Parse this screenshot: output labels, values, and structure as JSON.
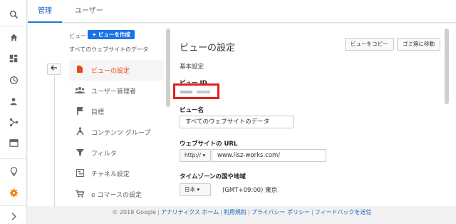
{
  "rail": {
    "icons": [
      "search-icon",
      "home-icon",
      "dashboard-icon",
      "clock-icon",
      "person-icon",
      "acquisition-icon",
      "behavior-icon",
      "lightbulb-icon",
      "gear-icon",
      "chevron-right-icon"
    ],
    "active_color": "#f57c00"
  },
  "tabs": {
    "admin": "管理",
    "user": "ユーザー"
  },
  "view_column": {
    "label": "ビュー",
    "create_button": "+ ビューを作成",
    "view_name": "すべてのウェブサイトのデータ",
    "items": [
      {
        "label": "ビューの設定",
        "icon": "document-icon"
      },
      {
        "label": "ユーザー管理者",
        "icon": "people-icon"
      },
      {
        "label": "目標",
        "icon": "flag-icon"
      },
      {
        "label": "コンテンツ グループ",
        "icon": "content-group-icon"
      },
      {
        "label": "フィルタ",
        "icon": "filter-icon"
      },
      {
        "label": "チャネル設定",
        "icon": "channel-icon"
      },
      {
        "label": "e コマースの設定",
        "icon": "cart-icon"
      }
    ]
  },
  "settings": {
    "title": "ビューの設定",
    "copy_button": "ビューをコピー",
    "trash_button": "ゴミ箱に移動",
    "basic_section": "基本設定",
    "view_id_label": "ビュー ID",
    "view_name_label": "ビュー名",
    "view_name_value": "すべてのウェブサイトのデータ",
    "url_label": "ウェブサイトの URL",
    "url_protocol": "http:// ▾",
    "url_value": "www.lisz-works.com/",
    "timezone_label": "タイムゾーンの国や地域",
    "timezone_country": "日本 ▾",
    "timezone_value": "(GMT+09:00) 東京"
  },
  "footer": {
    "copyright": "© 2018 Google",
    "links": [
      "アナリティクス ホーム",
      "利用規約",
      "プライバシー ポリシー",
      "フィードバックを送信"
    ]
  },
  "colors": {
    "accent": "#1a73e8",
    "active_item": "#e64a19",
    "highlight_box": "#e32020"
  }
}
